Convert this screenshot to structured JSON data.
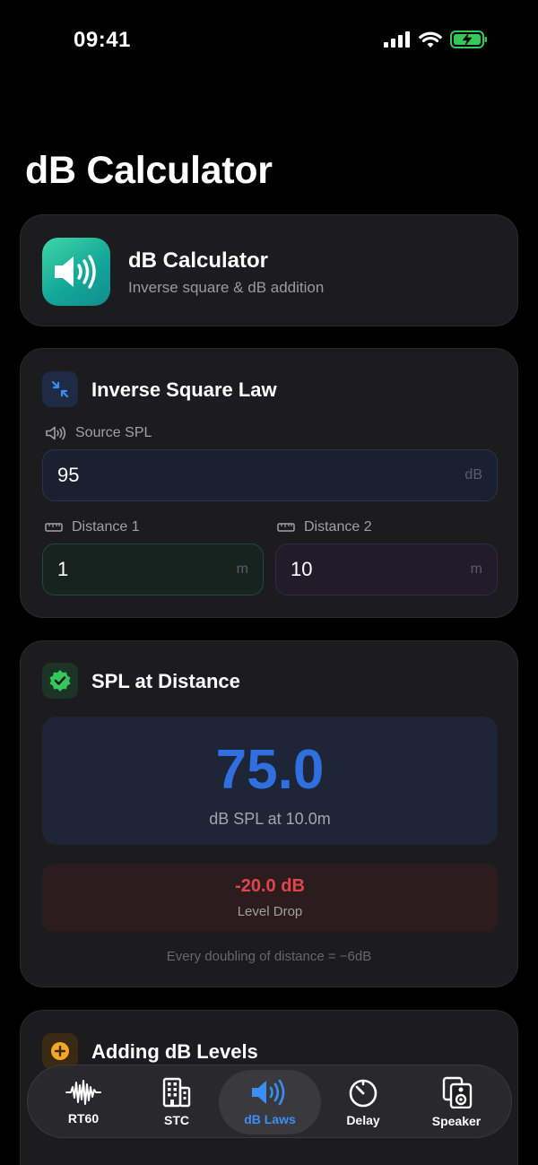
{
  "status": {
    "time": "09:41"
  },
  "page": {
    "title": "dB Calculator"
  },
  "header_card": {
    "title": "dB Calculator",
    "subtitle": "Inverse square & dB addition"
  },
  "inverse_square": {
    "title": "Inverse Square Law",
    "source_label": "Source SPL",
    "source_value": "95",
    "source_unit": "dB",
    "distance1_label": "Distance 1",
    "distance1_value": "1",
    "distance1_unit": "m",
    "distance2_label": "Distance 2",
    "distance2_value": "10",
    "distance2_unit": "m"
  },
  "spl_result": {
    "title": "SPL at Distance",
    "value": "75.0",
    "caption": "dB SPL at 10.0m",
    "drop_value": "-20.0 dB",
    "drop_label": "Level Drop",
    "note": "Every doubling of distance = −6dB"
  },
  "adding": {
    "title": "Adding dB Levels"
  },
  "tabs": [
    {
      "label": "RT60",
      "icon": "waveform-icon"
    },
    {
      "label": "STC",
      "icon": "building-icon"
    },
    {
      "label": "dB Laws",
      "icon": "speaker-wave-icon"
    },
    {
      "label": "Delay",
      "icon": "timer-icon"
    },
    {
      "label": "Speaker",
      "icon": "hifi-speaker-icon"
    }
  ],
  "colors": {
    "accent": "#2f6fe0",
    "tab_active": "#3a8ef5",
    "level_drop": "#e0454a",
    "check_green": "#34c759",
    "add_orange": "#f5a623"
  }
}
